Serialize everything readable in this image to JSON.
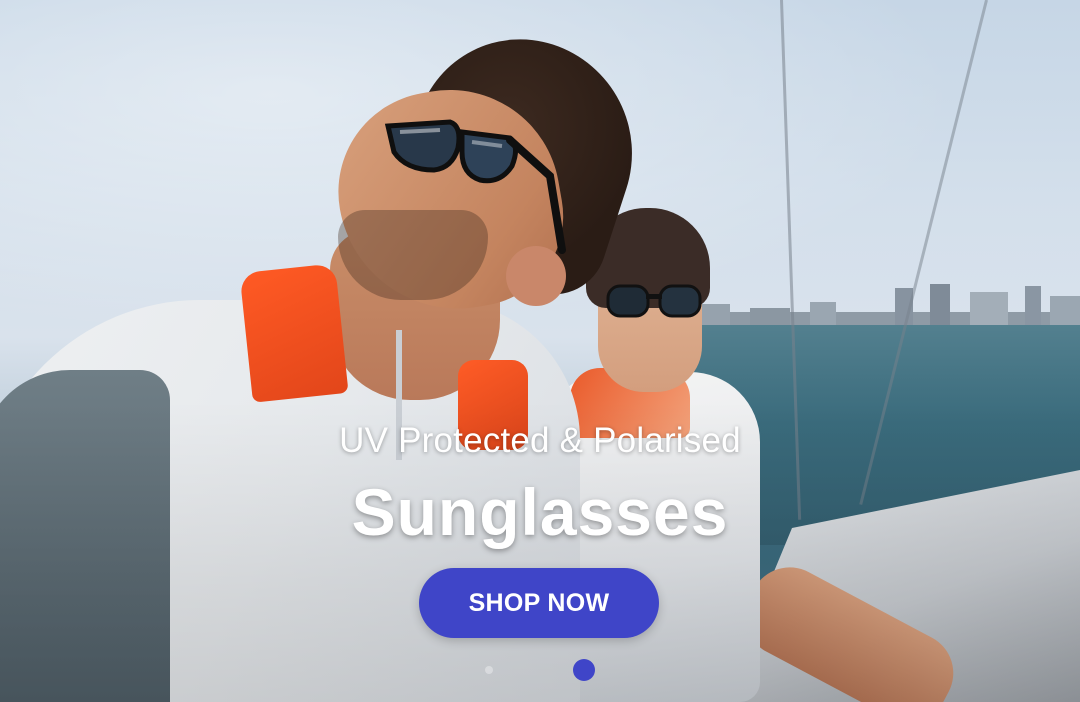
{
  "hero": {
    "subtitle": "UV Protected & Polarised",
    "title": "Sunglasses",
    "cta_label": "SHOP NOW",
    "accent_color": "#3f45c8"
  },
  "carousel": {
    "slide_count": 2,
    "active_index": 1
  }
}
